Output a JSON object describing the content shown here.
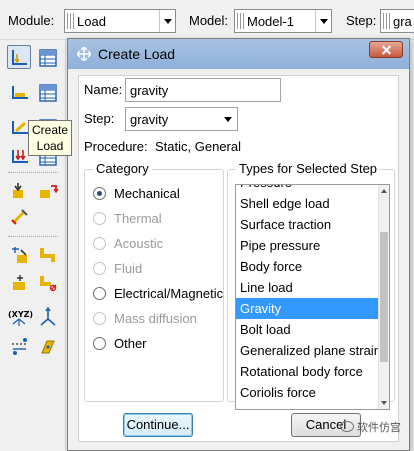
{
  "topbar": {
    "module_label": "Module:",
    "module_value": "Load",
    "model_label": "Model:",
    "model_value": "Model-1",
    "step_label": "Step:",
    "step_value": "gra"
  },
  "tooltip": {
    "line1": "Create",
    "line2": "Load"
  },
  "dialog": {
    "title": "Create Load",
    "name_label": "Name:",
    "name_value": "gravity",
    "step_label": "Step:",
    "step_value": "gravity",
    "procedure_label": "Procedure:",
    "procedure_value": "Static, General",
    "category_title": "Category",
    "categories": [
      {
        "label": "Mechanical",
        "selected": true,
        "enabled": true
      },
      {
        "label": "Thermal",
        "selected": false,
        "enabled": false
      },
      {
        "label": "Acoustic",
        "selected": false,
        "enabled": false
      },
      {
        "label": "Fluid",
        "selected": false,
        "enabled": false
      },
      {
        "label": "Electrical/Magnetic",
        "selected": false,
        "enabled": true
      },
      {
        "label": "Mass diffusion",
        "selected": false,
        "enabled": false
      },
      {
        "label": "Other",
        "selected": false,
        "enabled": true
      }
    ],
    "types_title": "Types for Selected Step",
    "types": [
      "Pressure",
      "Shell edge load",
      "Surface traction",
      "Pipe pressure",
      "Body force",
      "Line load",
      "Gravity",
      "Bolt load",
      "Generalized plane strain",
      "Rotational body force",
      "Coriolis force"
    ],
    "selected_type": "Gravity",
    "continue_label": "Continue...",
    "cancel_label": "Cancel"
  },
  "watermark": "软件仿宫",
  "colors": {
    "selection": "#3399ff",
    "titlebar": "#99b4d1",
    "close_button": "#c75050"
  }
}
